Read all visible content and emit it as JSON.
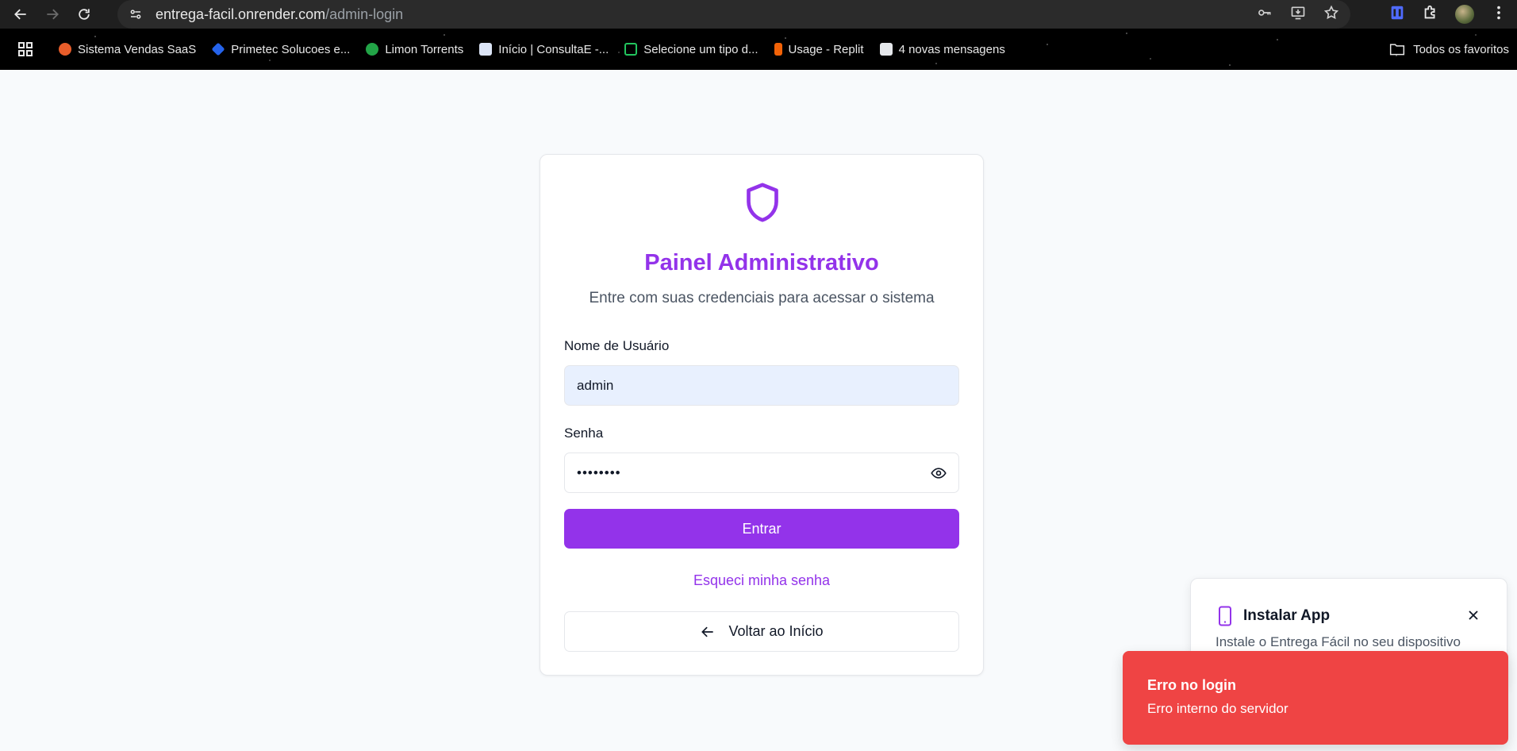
{
  "browser": {
    "url_host": "entrega-facil.onrender.com",
    "url_path": "/admin-login",
    "bookmarks": [
      {
        "label": "Sistema Vendas SaaS",
        "color": "#e85d2a"
      },
      {
        "label": "Primetec Solucoes e...",
        "color": "#2563eb"
      },
      {
        "label": "Limon Torrents",
        "color": "#22a447"
      },
      {
        "label": "Início | ConsultaE -...",
        "color": "#dbe4f5"
      },
      {
        "label": "Selecione um tipo d...",
        "color": "#22c55e"
      },
      {
        "label": "Usage - Replit",
        "color": "#f26207"
      },
      {
        "label": "4 novas mensagens",
        "color": "#e5e7eb"
      }
    ],
    "all_bookmarks_label": "Todos os favoritos"
  },
  "login": {
    "title": "Painel Administrativo",
    "subtitle": "Entre com suas credenciais para acessar o sistema",
    "username_label": "Nome de Usuário",
    "username_value": "admin",
    "password_label": "Senha",
    "password_value": "••••••••",
    "submit_label": "Entrar",
    "forgot_label": "Esqueci minha senha",
    "back_label": "Voltar ao Início",
    "accent_color": "#9333ea"
  },
  "install_popup": {
    "title": "Instalar App",
    "description": "Instale o Entrega Fácil no seu dispositivo"
  },
  "toast": {
    "title": "Erro no login",
    "description": "Erro interno do servidor",
    "color": "#ef4444"
  }
}
